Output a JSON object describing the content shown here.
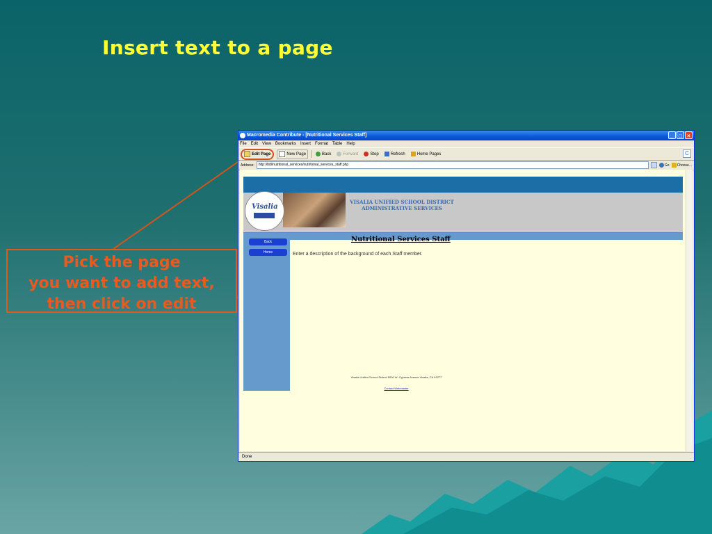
{
  "slide": {
    "title": "Insert text to a page",
    "callout_lines": [
      "Pick the page",
      "you want to add text,",
      "then click on edit"
    ]
  },
  "window": {
    "title": "Macromedia Contribute - [Nutritional Services Staff]",
    "menu": [
      "File",
      "Edit",
      "View",
      "Bookmarks",
      "Insert",
      "Format",
      "Table",
      "Help"
    ],
    "toolbar": {
      "edit_page": "Edit Page",
      "new_page": "New Page",
      "back": "Back",
      "forward": "Forward",
      "stop": "Stop",
      "refresh": "Refresh",
      "home_pages": "Home Pages"
    },
    "address_label": "Address:",
    "address_value": "http://bdl/nutritional_services/nutritional_services_staff.php",
    "go_label": "Go",
    "choose_label": "Choose...",
    "status": "Done"
  },
  "webpage": {
    "logo_text": "Visalia",
    "school_name_line1": "VISALIA UNIFIED SCHOOL DISTRICT",
    "school_name_line2": "ADMINISTRATIVE SERVICES",
    "nav": [
      "Back",
      "Home"
    ],
    "page_title": "Nutritional Services Staff",
    "description": "Enter a description of the background of each Staff member.",
    "footer_address": "Visalia Unified School District 5000 W. Cypress Avenue Visalia, CA 93277",
    "footer_link": "Contact Webmaster"
  },
  "colors": {
    "title_yellow": "#ffff33",
    "callout_orange": "#e85a20",
    "xp_blue": "#0a57d8"
  }
}
